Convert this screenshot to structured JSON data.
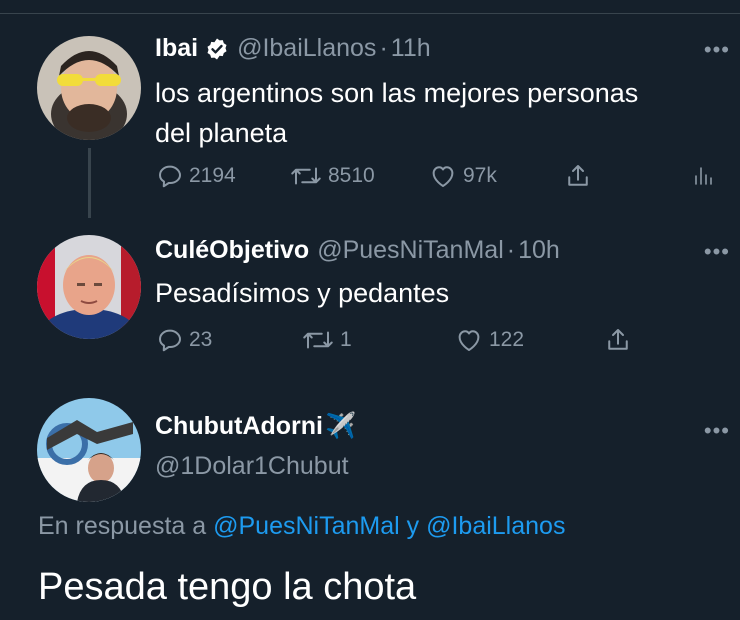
{
  "tweets": [
    {
      "name": "Ibai",
      "handle": "@IbaiLlanos",
      "separator": "·",
      "time": "11h",
      "verified": true,
      "text_lines": [
        "los argentinos son las mejores personas",
        "del planeta"
      ],
      "replies": "2194",
      "retweets": "8510",
      "likes": "97k"
    },
    {
      "name": "CuléObjetivo",
      "handle": "@PuesNiTanMal",
      "separator": "·",
      "time": "10h",
      "text": "Pesadísimos y pedantes",
      "replies": "23",
      "retweets": "1",
      "likes": "122"
    }
  ],
  "main_tweet": {
    "name": "ChubutAdorni",
    "name_emoji": "✈️",
    "handle": "@1Dolar1Chubut",
    "reply_prefix": "En respuesta a",
    "reply_mention_1": "@PuesNiTanMal",
    "reply_conjunction": "y",
    "reply_mention_2": "@IbaiLlanos",
    "text": "Pesada tengo la chota"
  },
  "icons": {
    "more": "more-icon",
    "reply": "reply-icon",
    "retweet": "retweet-icon",
    "like": "heart-icon",
    "share": "share-icon",
    "analytics": "analytics-icon",
    "verified": "verified-badge-icon"
  },
  "colors": {
    "background": "#15202b",
    "muted": "#8b98a5",
    "accent": "#1d9bf0",
    "divider": "#38444d"
  },
  "more_glyph": "•••"
}
